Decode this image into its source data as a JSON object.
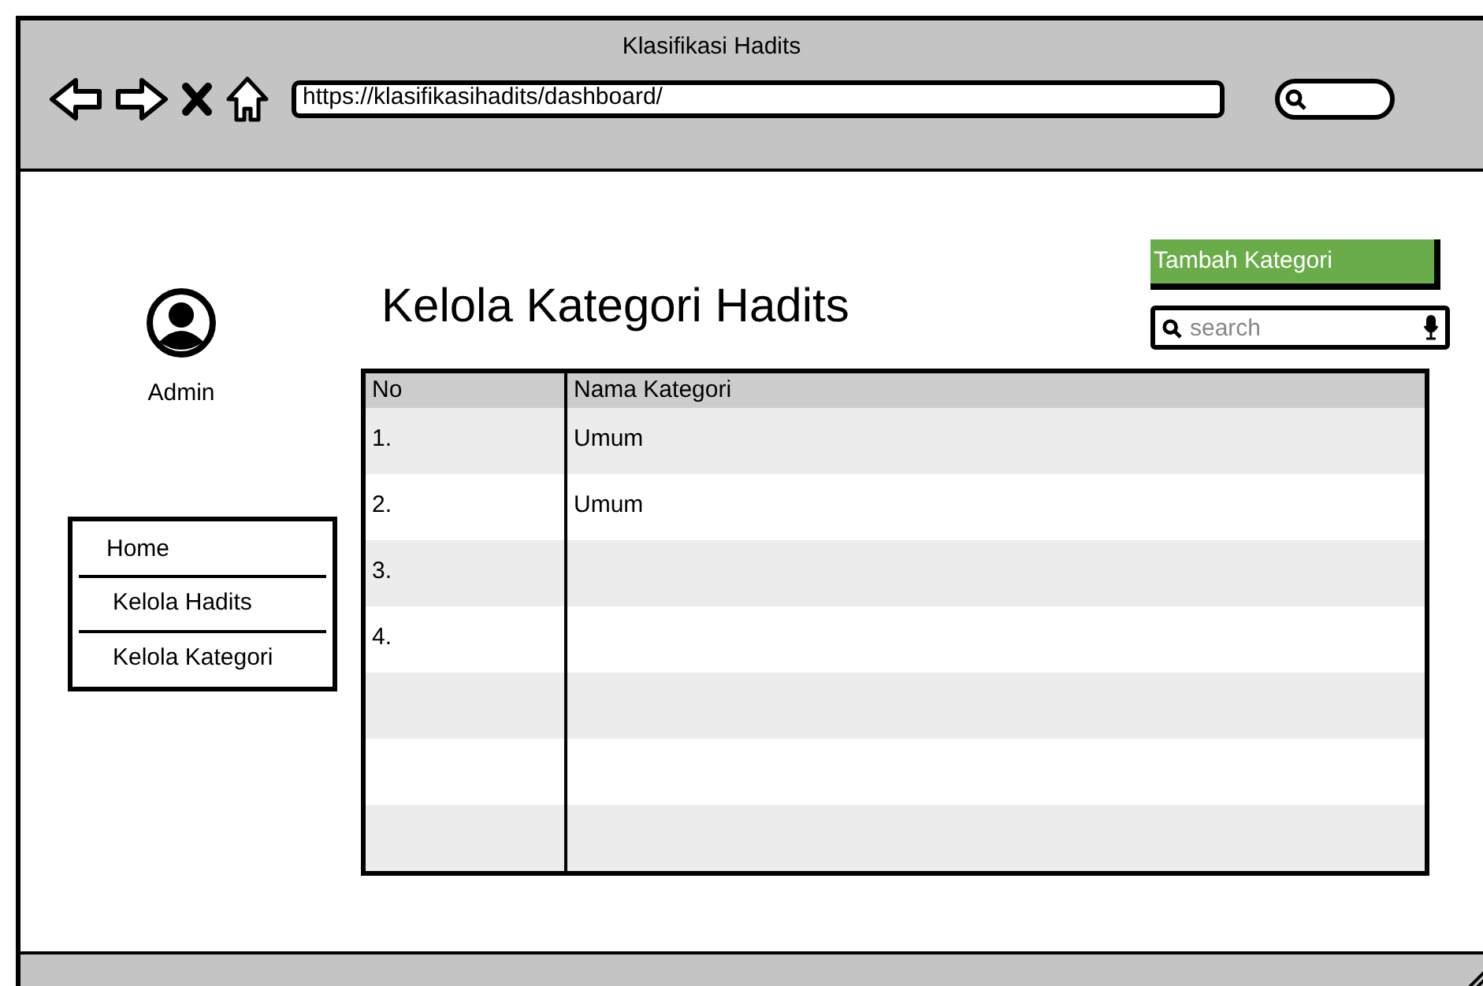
{
  "window": {
    "title": "Klasifikasi Hadits"
  },
  "browser": {
    "url": "https://klasifikasihadits/dashboard/"
  },
  "sidebar": {
    "user": "Admin",
    "menu": [
      "Home",
      "Kelola Hadits",
      "Kelola Kategori"
    ]
  },
  "page": {
    "title": "Kelola Kategori Hadits",
    "add_button": "Tambah Kategori",
    "search": {
      "placeholder": "search"
    }
  },
  "table": {
    "columns": [
      "No",
      "Nama Kategori"
    ],
    "rows": [
      [
        "1.",
        "Umum"
      ],
      [
        "2.",
        "Umum"
      ],
      [
        "3.",
        ""
      ],
      [
        "4.",
        ""
      ]
    ]
  }
}
